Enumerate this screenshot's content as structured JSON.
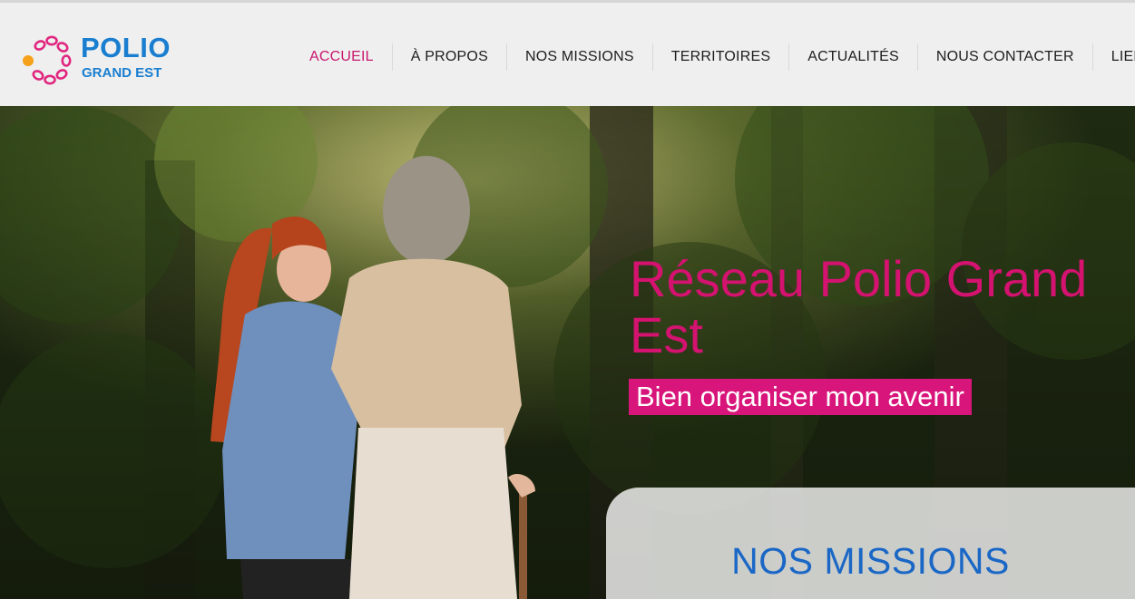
{
  "brand": {
    "name_line1": "POLIO",
    "name_line2": "GRAND EST",
    "primary_color": "#1a7ed0",
    "accent_color": "#d4126f"
  },
  "nav": {
    "items": [
      {
        "label": "ACCUEIL",
        "active": true
      },
      {
        "label": "À PROPOS"
      },
      {
        "label": "NOS MISSIONS"
      },
      {
        "label": "TERRITOIRES"
      },
      {
        "label": "ACTUALITÉS"
      },
      {
        "label": "NOUS CONTACTER"
      },
      {
        "label": "LIEN"
      }
    ]
  },
  "hero": {
    "title": "Réseau Polio Grand Est",
    "tagline": "Bien organiser mon avenir",
    "image_icon": "forest-walk-photo"
  },
  "missions": {
    "title": "NOS MISSIONS"
  }
}
